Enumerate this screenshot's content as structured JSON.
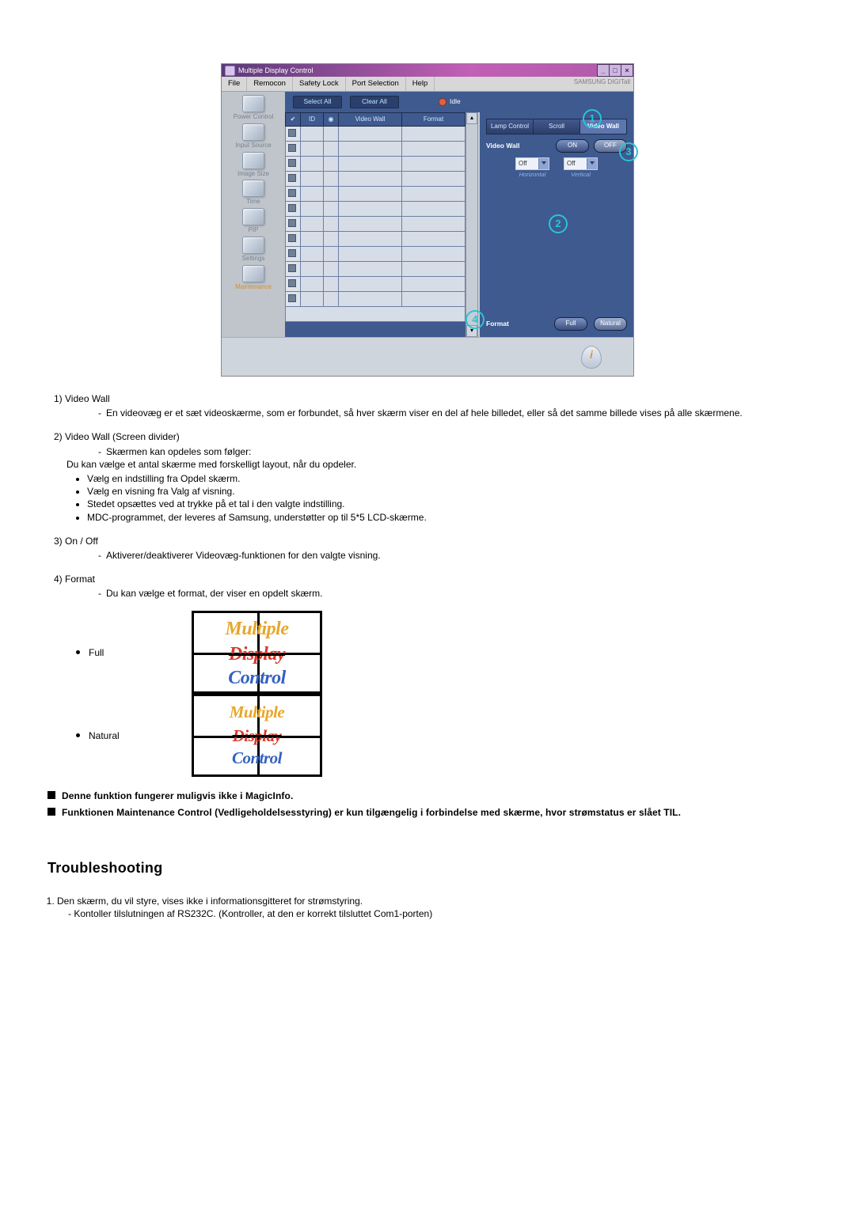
{
  "app": {
    "title": "Multiple Display Control",
    "brand": "SAMSUNG DIGITall",
    "menu": {
      "file": "File",
      "remocon": "Remocon",
      "safety_lock": "Safety Lock",
      "port_selection": "Port Selection",
      "help": "Help"
    },
    "toolbar": {
      "select_all": "Select All",
      "clear_all": "Clear All",
      "idle": "Idle"
    },
    "sidebar": {
      "power_control": "Power Control",
      "input_source": "Input Source",
      "image_size": "Image Size",
      "time": "Time",
      "pip": "PIP",
      "settings": "Settings",
      "maintenance": "Maintenance"
    },
    "grid_headers": {
      "check": "",
      "id": "ID",
      "sel": "",
      "video_wall": "Video Wall",
      "format": "Format"
    },
    "right": {
      "tabs": {
        "lamp": "Lamp Control",
        "scroll": "Scroll",
        "video_wall": "Video Wall"
      },
      "video_wall_label": "Video Wall",
      "on": "ON",
      "off": "OFF",
      "horiz_value": "Off",
      "vert_value": "Off",
      "horiz_label": "Horizontal",
      "vert_label": "Vertical",
      "format_label": "Format",
      "full": "Full",
      "natural": "Natural"
    },
    "callouts": {
      "c1": "1",
      "c2": "2",
      "c3": "3",
      "c4": "4"
    }
  },
  "doc": {
    "items": {
      "i1": {
        "num": "1)",
        "title": "Video Wall",
        "dash": "En videovæg er et sæt videoskærme, som er forbundet, så hver skærm viser en del af hele billedet, eller så det samme billede vises på alle skærmene."
      },
      "i2": {
        "num": "2)",
        "title": "Video Wall (Screen divider)",
        "dash": "Skærmen kan opdeles som følger:",
        "plain": "Du kan vælge et antal skærme med forskelligt layout, når du opdeler.",
        "b1": "Vælg en indstilling fra Opdel skærm.",
        "b2": "Vælg en visning fra Valg af visning.",
        "b3": "Stedet opsættes ved at trykke på et tal i den valgte indstilling.",
        "b4": "MDC-programmet, der leveres af Samsung, understøtter op til 5*5 LCD-skærme."
      },
      "i3": {
        "num": "3)",
        "title": "On / Off",
        "dash": "Aktiverer/deaktiverer Videovæg-funktionen for den valgte visning."
      },
      "i4": {
        "num": "4)",
        "title": "Format",
        "dash": "Du kan vælge et format, der viser en opdelt skærm."
      }
    },
    "format_rows": {
      "full": "Full",
      "natural": "Natural"
    },
    "thumb": {
      "l1": "Multiple",
      "l2": "Display",
      "l3": "Control"
    },
    "notes": {
      "n1": "Denne funktion fungerer muligvis ikke i MagicInfo.",
      "n2": "Funktionen Maintenance Control (Vedligeholdelsesstyring) er kun tilgængelig i forbindelse med skærme, hvor strømstatus er slået TIL."
    },
    "troubleshooting": {
      "header": "Troubleshooting",
      "t1": "Den skærm, du vil styre, vises ikke i informationsgitteret for strømstyring.",
      "t1a": "- Kontoller tilslutningen af RS232C. (Kontroller, at den er korrekt tilsluttet Com1-porten)"
    }
  }
}
